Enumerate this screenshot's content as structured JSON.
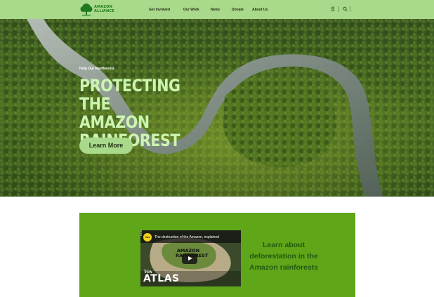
{
  "brand": {
    "name_line1": "AMAZON",
    "name_line2": "ALLIANCE",
    "logo_icon": "tree-icon",
    "color": "#1f7a1f"
  },
  "nav": {
    "items": [
      {
        "label": "Get Involved"
      },
      {
        "label": "Our Work"
      },
      {
        "label": "News"
      },
      {
        "label": "Donate"
      },
      {
        "label": "About Us"
      }
    ],
    "utility_icons": [
      "user-icon",
      "search-icon"
    ]
  },
  "hero": {
    "kicker": "Help Our Rainforests",
    "headline": [
      "PROTECTING THE",
      "AMAZON",
      "RAINFOREST"
    ],
    "cta_label": "Learn More",
    "headline_color": "#cbf5b0"
  },
  "video": {
    "channel_badge": "Vox",
    "title": "The destruction of the Amazon, explained",
    "map_label": "AMAZON RAINFOREST",
    "brand_small": "Vox",
    "brand_large": "ATLAS",
    "caption": [
      "Learn about",
      "deforestation in the",
      "Amazon rainforests"
    ],
    "band_color": "#5fa618"
  },
  "colors": {
    "header": "#a9d98a",
    "accent": "#a9d98a"
  }
}
